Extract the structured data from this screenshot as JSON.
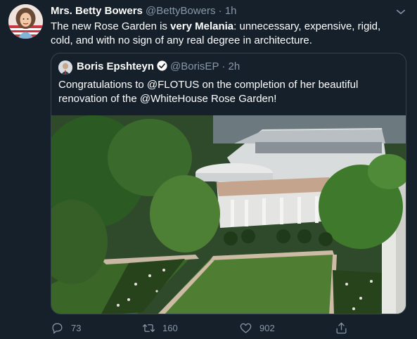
{
  "tweet": {
    "name": "Mrs. Betty Bowers",
    "handle": "@BettyBowers",
    "separator": "·",
    "time": "1h",
    "text_before": "The new Rose Garden is ",
    "text_bold": "very Melania",
    "text_after": ": unnecessary, expensive, rigid, cold, and with no sign of any real degree in architecture."
  },
  "quoted": {
    "name": "Boris Epshteyn",
    "handle": "@BorisEP",
    "separator": "·",
    "time": "2h",
    "text": "Congratulations to @FLOTUS on the completion of her beautiful renovation of the @WhiteHouse Rose Garden!"
  },
  "actions": {
    "replies": "73",
    "retweets": "160",
    "likes": "902"
  },
  "icons": {
    "caret": "chevron-down-icon",
    "verified": "verified-badge-icon",
    "reply": "reply-icon",
    "retweet": "retweet-icon",
    "like": "heart-icon",
    "share": "share-icon"
  },
  "colors": {
    "background": "#15202b",
    "secondary_text": "#8899a6",
    "border": "#38444d",
    "verified": "#1da1f2"
  }
}
